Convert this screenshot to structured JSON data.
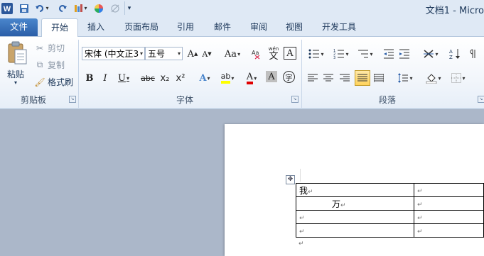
{
  "title": "文档1 - Micro",
  "quick_access": {
    "word_logo": "W",
    "save_icon": "save-icon",
    "undo_icon": "undo-icon",
    "redo_icon": "redo-icon",
    "customize_icon": "customize-icon"
  },
  "tabs": [
    {
      "label": "文件"
    },
    {
      "label": "开始"
    },
    {
      "label": "插入"
    },
    {
      "label": "页面布局"
    },
    {
      "label": "引用"
    },
    {
      "label": "邮件"
    },
    {
      "label": "审阅"
    },
    {
      "label": "视图"
    },
    {
      "label": "开发工具"
    }
  ],
  "clipboard": {
    "paste_label": "粘贴",
    "cut_label": "剪切",
    "copy_label": "复制",
    "format_painter_label": "格式刷",
    "group_label": "剪贴板"
  },
  "font": {
    "font_name": "宋体 (中文正3",
    "font_size": "五号",
    "grow": "A",
    "shrink": "A",
    "change_case": "Aa",
    "bold": "B",
    "italic": "I",
    "underline": "U",
    "strikethrough": "abc",
    "subscript": "x₂",
    "superscript": "x²",
    "text_effect": "A",
    "highlight": "ab",
    "font_color": "A",
    "char_shading": "A",
    "enclose": "字",
    "phonetic": "文",
    "phonetic_top": "wén",
    "char_border": "A",
    "group_label": "字体"
  },
  "paragraph": {
    "group_label": "段落"
  },
  "document": {
    "table": [
      [
        "我",
        ""
      ],
      [
        "万",
        ""
      ],
      [
        "",
        ""
      ],
      [
        "",
        ""
      ]
    ],
    "para_mark": "↵"
  },
  "colors": {
    "file_tab": "#2a5ea8",
    "highlight_yellow": "#ffff00",
    "font_red": "#e00000",
    "active_button": "#ffd35c"
  }
}
